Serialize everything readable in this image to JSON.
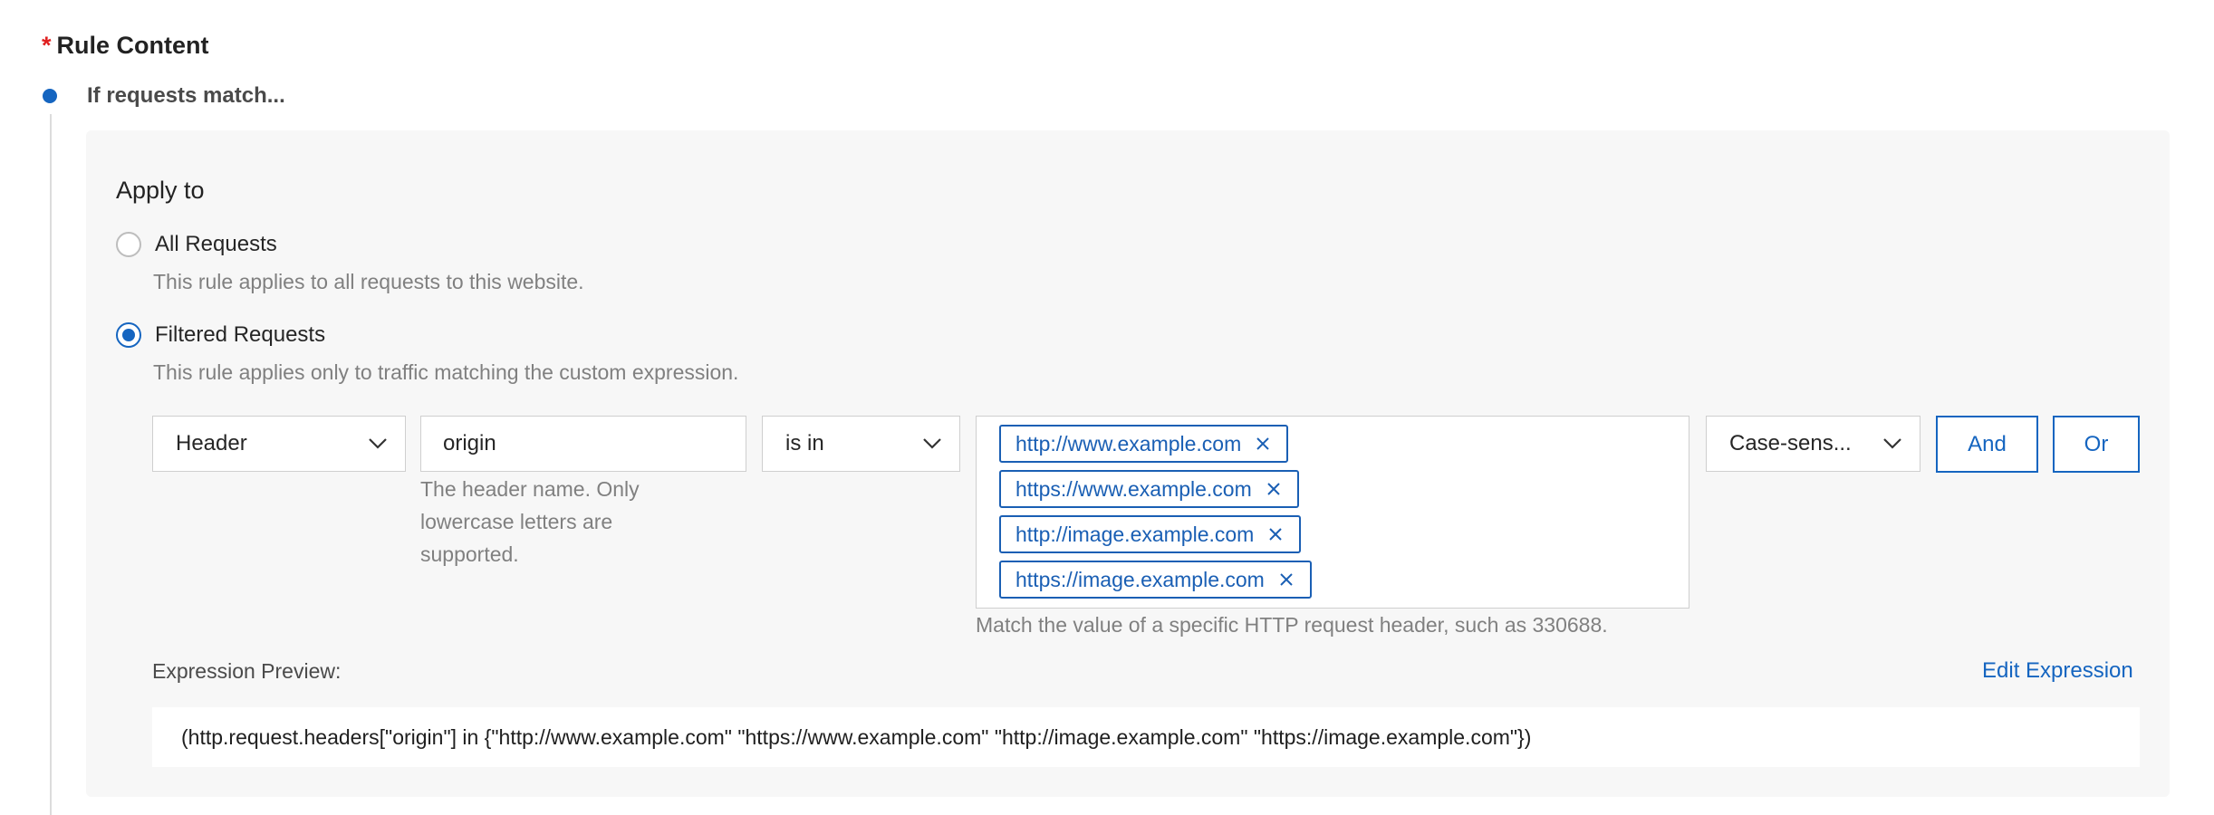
{
  "section": {
    "required_mark": "*",
    "title": "Rule Content"
  },
  "timeline": {
    "step_title": "If requests match..."
  },
  "apply_to": {
    "title": "Apply to",
    "options": [
      {
        "label": "All Requests",
        "description": "This rule applies to all requests to this website.",
        "checked": false
      },
      {
        "label": "Filtered Requests",
        "description": "This rule applies only to traffic matching the custom expression.",
        "checked": true
      }
    ]
  },
  "condition": {
    "field_select": "Header",
    "header_name_value": "origin",
    "header_name_hint": "The header name. Only lowercase letters are supported.",
    "operator_select": "is in",
    "values": [
      "http://www.example.com",
      "https://www.example.com",
      "http://image.example.com",
      "https://image.example.com"
    ],
    "values_hint": "Match the value of a specific HTTP request header, such as 330688.",
    "case_select": "Case-sens...",
    "and_label": "And",
    "or_label": "Or"
  },
  "preview": {
    "label": "Expression Preview:",
    "edit_label": "Edit Expression",
    "expression": "(http.request.headers[\"origin\"] in {\"http://www.example.com\" \"https://www.example.com\" \"http://image.example.com\" \"https://image.example.com\"})"
  },
  "colors": {
    "accent": "#1565c0",
    "required": "#e02020",
    "panel_bg": "#f7f7f7",
    "hint_text": "#808080"
  }
}
